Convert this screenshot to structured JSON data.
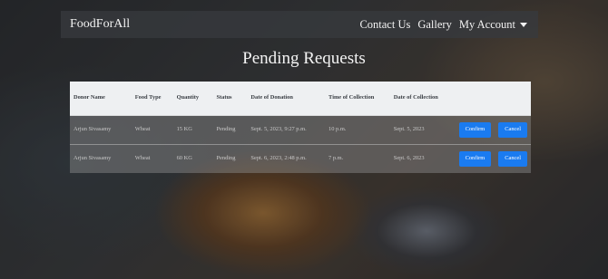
{
  "navbar": {
    "brand": "FoodForAll",
    "links": [
      "Contact Us",
      "Gallery",
      "My Account"
    ]
  },
  "page_title": "Pending Requests",
  "table": {
    "headers": [
      "Donor Name",
      "Food Type",
      "Quantity",
      "Status",
      "Date of Donation",
      "Time of Collection",
      "Date of Collection"
    ],
    "rows": [
      {
        "donor": "Arjun Sivasamy",
        "food_type": "Wheat",
        "quantity": "15 KG",
        "status": "Pending",
        "date_of_donation": "Sept. 5, 2023, 9:27 p.m.",
        "time_of_collection": "10 p.m.",
        "date_of_collection": "Sept. 5, 2023",
        "confirm": "Confirm",
        "cancel": "Cancel"
      },
      {
        "donor": "Arjun Sivasamy",
        "food_type": "Wheat",
        "quantity": "60 KG",
        "status": "Pending",
        "date_of_donation": "Sept. 6, 2023, 2:48 p.m.",
        "time_of_collection": "7 p.m.",
        "date_of_collection": "Sept. 6, 2023",
        "confirm": "Confirm",
        "cancel": "Cancel"
      }
    ]
  },
  "colors": {
    "primary_button": "#1a7bf0",
    "navbar": "#373a3e"
  }
}
